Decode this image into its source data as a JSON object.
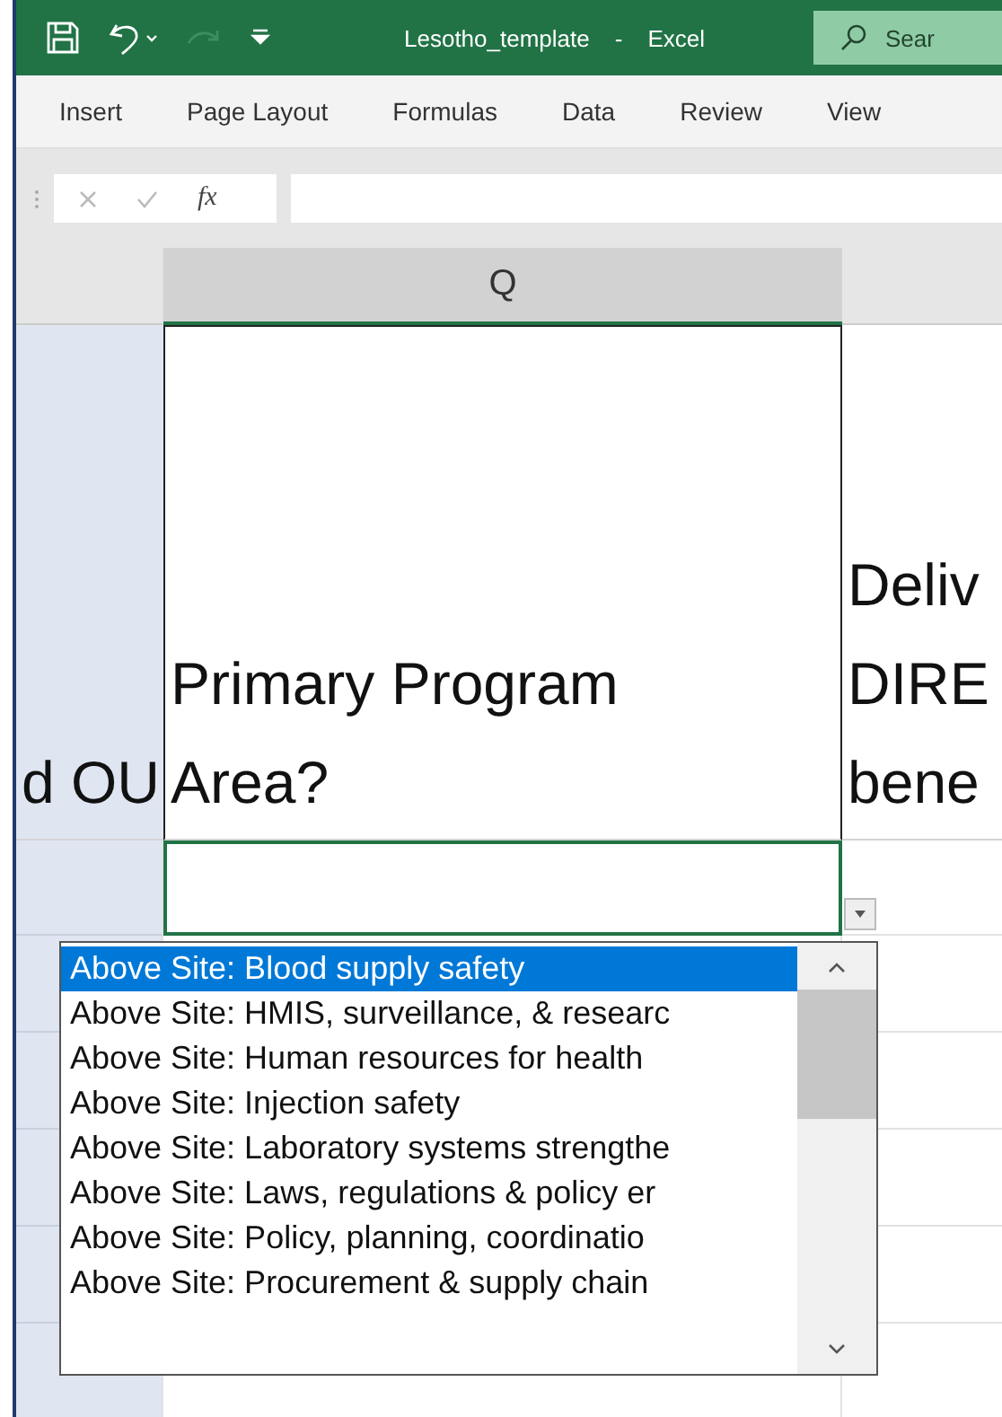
{
  "window": {
    "title": "Lesotho_template",
    "separator": "-",
    "app": "Excel"
  },
  "search": {
    "placeholder": "Sear"
  },
  "ribbon_tabs": [
    "Insert",
    "Page Layout",
    "Formulas",
    "Data",
    "Review",
    "View"
  ],
  "formula_bar": {
    "function_label": "fx"
  },
  "column_headers": [
    {
      "label": "Q",
      "selected": true
    }
  ],
  "header_row": [
    {
      "lines": [
        "d OU"
      ]
    },
    {
      "lines": [
        "Primary Program",
        "Area?"
      ]
    },
    {
      "lines": [
        "Deliv",
        "DIRE",
        "bene"
      ]
    }
  ],
  "dropdown": {
    "items": [
      {
        "label": "Above Site: Blood supply safety",
        "selected": true
      },
      {
        "label": "Above Site: HMIS, surveillance, & researc",
        "selected": false
      },
      {
        "label": "Above Site: Human resources for health",
        "selected": false
      },
      {
        "label": "Above Site: Injection safety",
        "selected": false
      },
      {
        "label": "Above Site: Laboratory systems strengthe",
        "selected": false
      },
      {
        "label": "Above Site: Laws, regulations & policy er",
        "selected": false
      },
      {
        "label": "Above Site: Policy, planning, coordinatio",
        "selected": false
      },
      {
        "label": "Above Site: Procurement & supply chain",
        "selected": false
      }
    ]
  }
}
